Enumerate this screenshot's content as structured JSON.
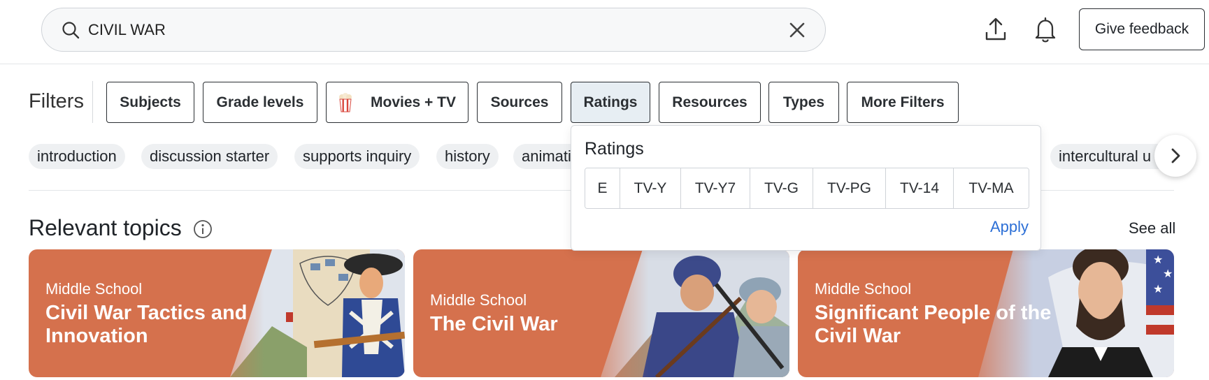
{
  "search": {
    "value": "CIVIL WAR",
    "placeholder": "Search"
  },
  "header": {
    "upload_icon": "upload-icon",
    "notifications_icon": "bell-icon",
    "feedback_label": "Give feedback"
  },
  "filters": {
    "label": "Filters",
    "buttons": [
      {
        "label": "Subjects"
      },
      {
        "label": "Grade levels"
      },
      {
        "label": "Movies + TV",
        "icon": "popcorn-icon"
      },
      {
        "label": "Sources"
      },
      {
        "label": "Ratings",
        "active": true
      },
      {
        "label": "Resources"
      },
      {
        "label": "Types"
      },
      {
        "label": "More Filters"
      }
    ]
  },
  "chips": [
    "introduction",
    "discussion starter",
    "supports inquiry",
    "history",
    "animati",
    "intercultural u"
  ],
  "ratings_dropdown": {
    "title": "Ratings",
    "options": [
      "E",
      "TV-Y",
      "TV-Y7",
      "TV-G",
      "TV-PG",
      "TV-14",
      "TV-MA"
    ],
    "apply_label": "Apply"
  },
  "topics": {
    "title": "Relevant topics",
    "see_all": "See all",
    "cards": [
      {
        "grade": "Middle School",
        "title_line1": "Civil War Tactics and",
        "title_line2": "Innovation"
      },
      {
        "grade": "Middle School",
        "title_line1": "The Civil War",
        "title_line2": ""
      },
      {
        "grade": "Middle School",
        "title_line1": "Significant People of the",
        "title_line2": "Civil War"
      }
    ]
  },
  "colors": {
    "card_bg": "#d5714d",
    "apply_link": "#2c6fd6",
    "active_filter_bg": "#e7eef3"
  }
}
